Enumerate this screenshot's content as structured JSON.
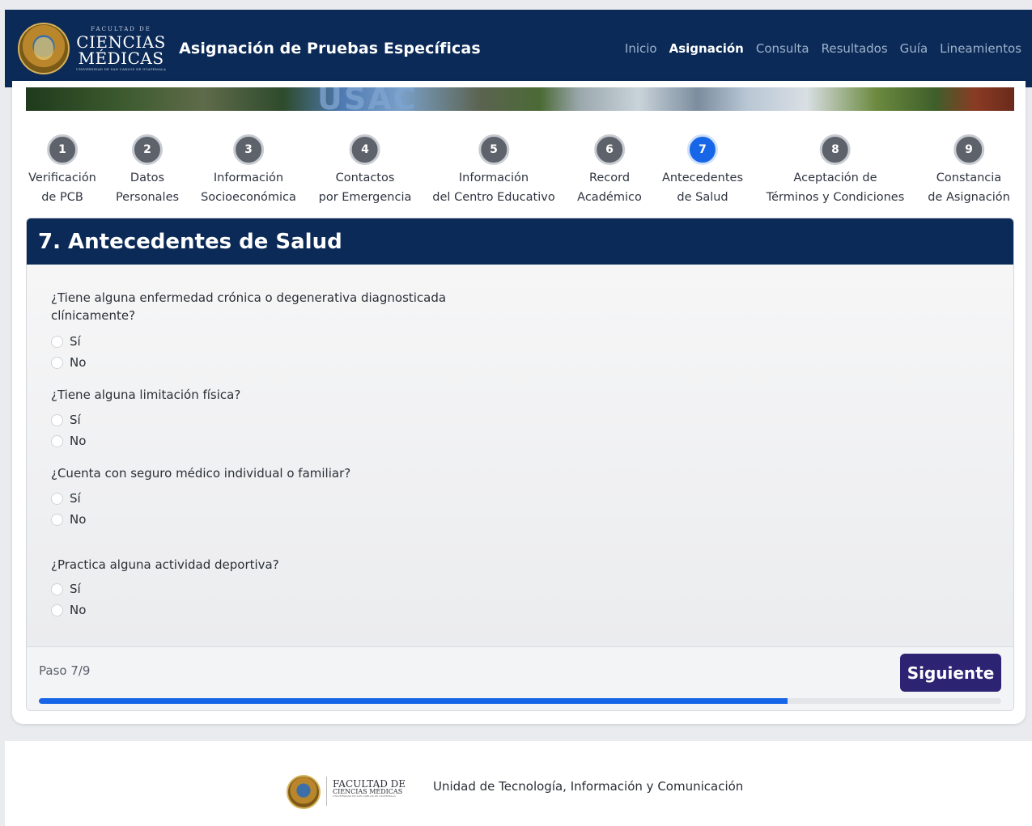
{
  "header": {
    "logo_small": "FACULTAD DE",
    "logo_line1": "CIENCIAS",
    "logo_line2": "MÉDICAS",
    "logo_tiny": "UNIVERSIDAD DE SAN CARLOS DE GUATEMALA",
    "title": "Asignación de Pruebas Específicas",
    "nav": [
      "Inicio",
      "Asignación",
      "Consulta",
      "Resultados",
      "Guía",
      "Lineamientos"
    ],
    "active_nav": "Asignación"
  },
  "banner": {
    "word": "USAC"
  },
  "steps": [
    {
      "number": "1",
      "line1": "Verificación",
      "line2": "de PCB"
    },
    {
      "number": "2",
      "line1": "Datos",
      "line2": "Personales"
    },
    {
      "number": "3",
      "line1": "Información",
      "line2": "Socioeconómica"
    },
    {
      "number": "4",
      "line1": "Contactos",
      "line2": "por Emergencia"
    },
    {
      "number": "5",
      "line1": "Información",
      "line2": "del Centro Educativo"
    },
    {
      "number": "6",
      "line1": "Record",
      "line2": "Académico"
    },
    {
      "number": "7",
      "line1": "Antecedentes",
      "line2": "de Salud"
    },
    {
      "number": "8",
      "line1": "Aceptación de",
      "line2": "Términos y Condiciones"
    },
    {
      "number": "9",
      "line1": "Constancia",
      "line2": "de Asignación"
    }
  ],
  "active_step": 7,
  "section": {
    "title": "7. Antecedentes de Salud",
    "questions": [
      {
        "text": "¿Tiene alguna enfermedad crónica o degenerativa diagnosticada clínicamente?",
        "options": [
          "Sí",
          "No"
        ]
      },
      {
        "text": "¿Tiene alguna limitación física?",
        "options": [
          "Sí",
          "No"
        ]
      },
      {
        "text": "¿Cuenta con seguro médico individual o familiar?",
        "options": [
          "Sí",
          "No"
        ]
      },
      {
        "text": "¿Practica alguna actividad deportiva?",
        "options": [
          "Sí",
          "No"
        ]
      }
    ],
    "step_text": "Paso 7/9",
    "next_label": "Siguiente",
    "progress_fraction": 0.778
  },
  "footer": {
    "logo_line1": "FACULTAD DE",
    "logo_line2": "CIENCIAS MÉDICAS",
    "logo_tiny": "UNIVERSIDAD DE SAN CARLOS DE GUATEMALA",
    "text": "Unidad de Tecnología, Información y Comunicación"
  },
  "colors": {
    "navy": "#0b2a57",
    "accent_blue": "#1766e8",
    "button": "#2c2473",
    "step_inactive": "#5e636b"
  }
}
